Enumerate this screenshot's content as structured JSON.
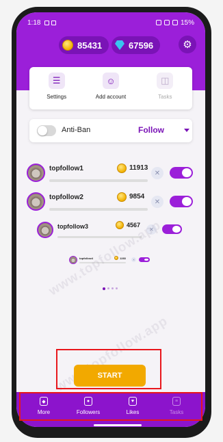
{
  "status_bar": {
    "time": "1:18",
    "battery": "15%"
  },
  "header": {
    "coins": "85431",
    "diamonds": "67596",
    "settings_icon": "gear-icon"
  },
  "menu": [
    {
      "label": "Settings",
      "icon": "sliders-icon",
      "enabled": true
    },
    {
      "label": "Add account",
      "icon": "add-user-icon",
      "enabled": true
    },
    {
      "label": "Tasks",
      "icon": "database-icon",
      "enabled": false
    }
  ],
  "anti_ban": {
    "label": "Anti-Ban",
    "enabled": false,
    "mode": "Follow"
  },
  "accounts": [
    {
      "name": "topfollow1",
      "coins": "11913",
      "active": true
    },
    {
      "name": "topfollow2",
      "coins": "9854",
      "active": true
    },
    {
      "name": "topfollow3",
      "coins": "4567",
      "active": true
    },
    {
      "name": "topfollow4",
      "coins": "1283",
      "active": true
    }
  ],
  "watermark": "www.topfollow.app",
  "start_button": "START",
  "bottom_nav": [
    {
      "label": "More",
      "icon": "shield-icon",
      "enabled": true
    },
    {
      "label": "Followers",
      "icon": "user-badge-icon",
      "enabled": true
    },
    {
      "label": "Likes",
      "icon": "heart-shield-icon",
      "enabled": true
    },
    {
      "label": "Tasks",
      "icon": "chat-icon",
      "enabled": false
    }
  ],
  "colors": {
    "brand": "#9b1fd9",
    "accent": "#f2a900",
    "highlight_box": "#e8161c"
  }
}
